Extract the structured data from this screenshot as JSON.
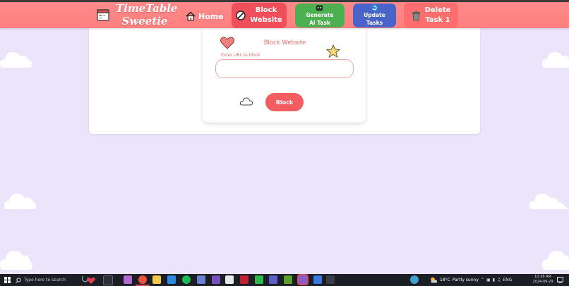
{
  "app": {
    "title_line1": "TimeTable",
    "title_line2": "Sweetie"
  },
  "nav": {
    "home_label": "Home",
    "block_line1": "Block",
    "block_line2": "Website",
    "ai_line1": "Generate",
    "ai_line2": "AI Task",
    "update_line1": "Update",
    "update_line2": "Tasks",
    "delete_line1": "Delete",
    "delete_line2": "Task 1"
  },
  "block_card": {
    "title": "Block Website",
    "url_field_label": "Enter URL to block",
    "url_value": "",
    "button_label": "Block"
  },
  "taskbar": {
    "search_placeholder": "Type here to search",
    "weather_temp": "18°C",
    "weather_desc": "Partly sunny",
    "language": "ENG",
    "time": "10:38 AM",
    "date": "2024-09-29"
  },
  "colors": {
    "navbar": "#ff7f7f",
    "block_button": "#f04e5a",
    "ai_button": "#4caf50",
    "update_button": "#4a63c9",
    "delete_button": "#ff6e6e",
    "page_background": "#ece4fb",
    "accent_text": "#f06a6a"
  },
  "icons": [
    "calendar-icon",
    "house-icon",
    "no-entry-icon",
    "robot-icon",
    "refresh-icon",
    "trash-icon",
    "heart-icon",
    "star-icon",
    "cloud-icon"
  ]
}
